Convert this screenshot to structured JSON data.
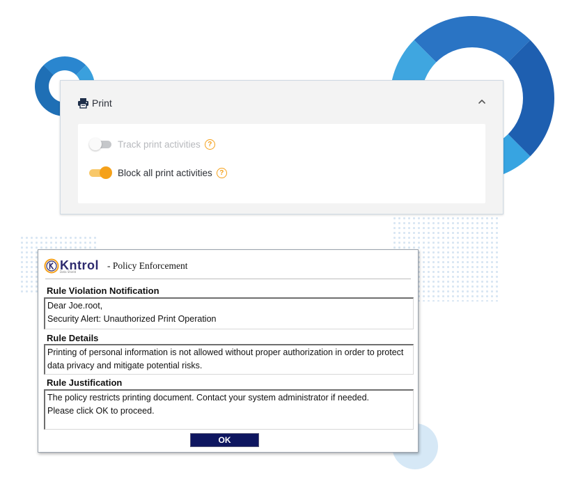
{
  "print_panel": {
    "title": "Print",
    "icon": "printer-icon",
    "collapse_icon": "chevron-up-icon",
    "options": [
      {
        "label": "Track print activities",
        "enabled": false,
        "help": "?"
      },
      {
        "label": "Block all print activities",
        "enabled": true,
        "help": "?"
      }
    ]
  },
  "dialog": {
    "logo_text": "Kntrol",
    "logo_subtext": "Data Shield",
    "title": "- Policy Enforcement",
    "sections": {
      "notification": {
        "title": "Rule Violation Notification",
        "lines": [
          "Dear Joe.root,",
          "Security Alert: Unauthorized Print Operation"
        ]
      },
      "details": {
        "title": "Rule Details",
        "lines": [
          "Printing of personal information is not allowed without proper authorization in order to protect data privacy and mitigate potential risks."
        ]
      },
      "justification": {
        "title": "Rule Justification",
        "lines": [
          "The policy restricts printing document. Contact your system administrator if needed.",
          "Please click OK to proceed."
        ]
      }
    },
    "ok_label": "OK"
  },
  "colors": {
    "accent_orange": "#f5a11a",
    "brand_navy": "#0e1660",
    "ring_blue": "#1f6fb5"
  }
}
